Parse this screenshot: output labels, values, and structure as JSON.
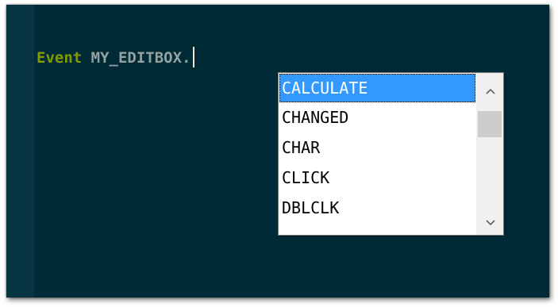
{
  "editor": {
    "keyword": "Event",
    "identifier": "MY_EDITBOX."
  },
  "autocomplete": {
    "selected_index": 0,
    "items": [
      {
        "label": "CALCULATE"
      },
      {
        "label": "CHANGED"
      },
      {
        "label": "CHAR"
      },
      {
        "label": "CLICK"
      },
      {
        "label": "DBLCLK"
      }
    ],
    "scroll_up_icon": "chevron-up-icon",
    "scroll_down_icon": "chevron-down-icon",
    "scroll_position": 0.1
  },
  "colors": {
    "editor_background": "#002b36",
    "gutter_background": "#073642",
    "keyword": "#859900",
    "identifier": "#93a1a1",
    "selection": "#3399ff"
  }
}
